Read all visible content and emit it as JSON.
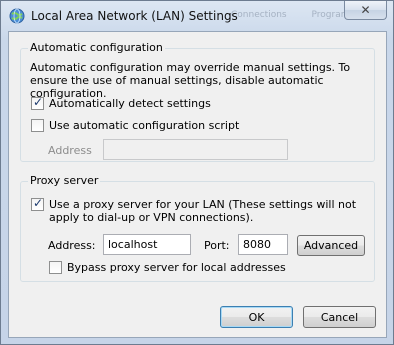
{
  "window": {
    "title": "Local Area Network (LAN) Settings",
    "background_tabs": [
      "Connections",
      "Programs"
    ]
  },
  "automatic_configuration": {
    "legend": "Automatic configuration",
    "description": "Automatic configuration may override manual settings.  To ensure the use of manual settings, disable automatic configuration.",
    "detect_label": "Automatically detect settings",
    "detect_checked": true,
    "script_label": "Use automatic configuration script",
    "script_checked": false,
    "address_label": "Address",
    "address_value": ""
  },
  "proxy_server": {
    "legend": "Proxy server",
    "use_proxy_label": "Use a proxy server for your LAN (These settings will not apply to dial-up or VPN connections).",
    "use_proxy_checked": true,
    "address_label": "Address:",
    "address_value": "localhost",
    "port_label": "Port:",
    "port_value": "8080",
    "advanced_label": "Advanced",
    "bypass_label": "Bypass proxy server for local addresses",
    "bypass_checked": false
  },
  "buttons": {
    "ok": "OK",
    "cancel": "Cancel",
    "close_glyph": "✕"
  }
}
